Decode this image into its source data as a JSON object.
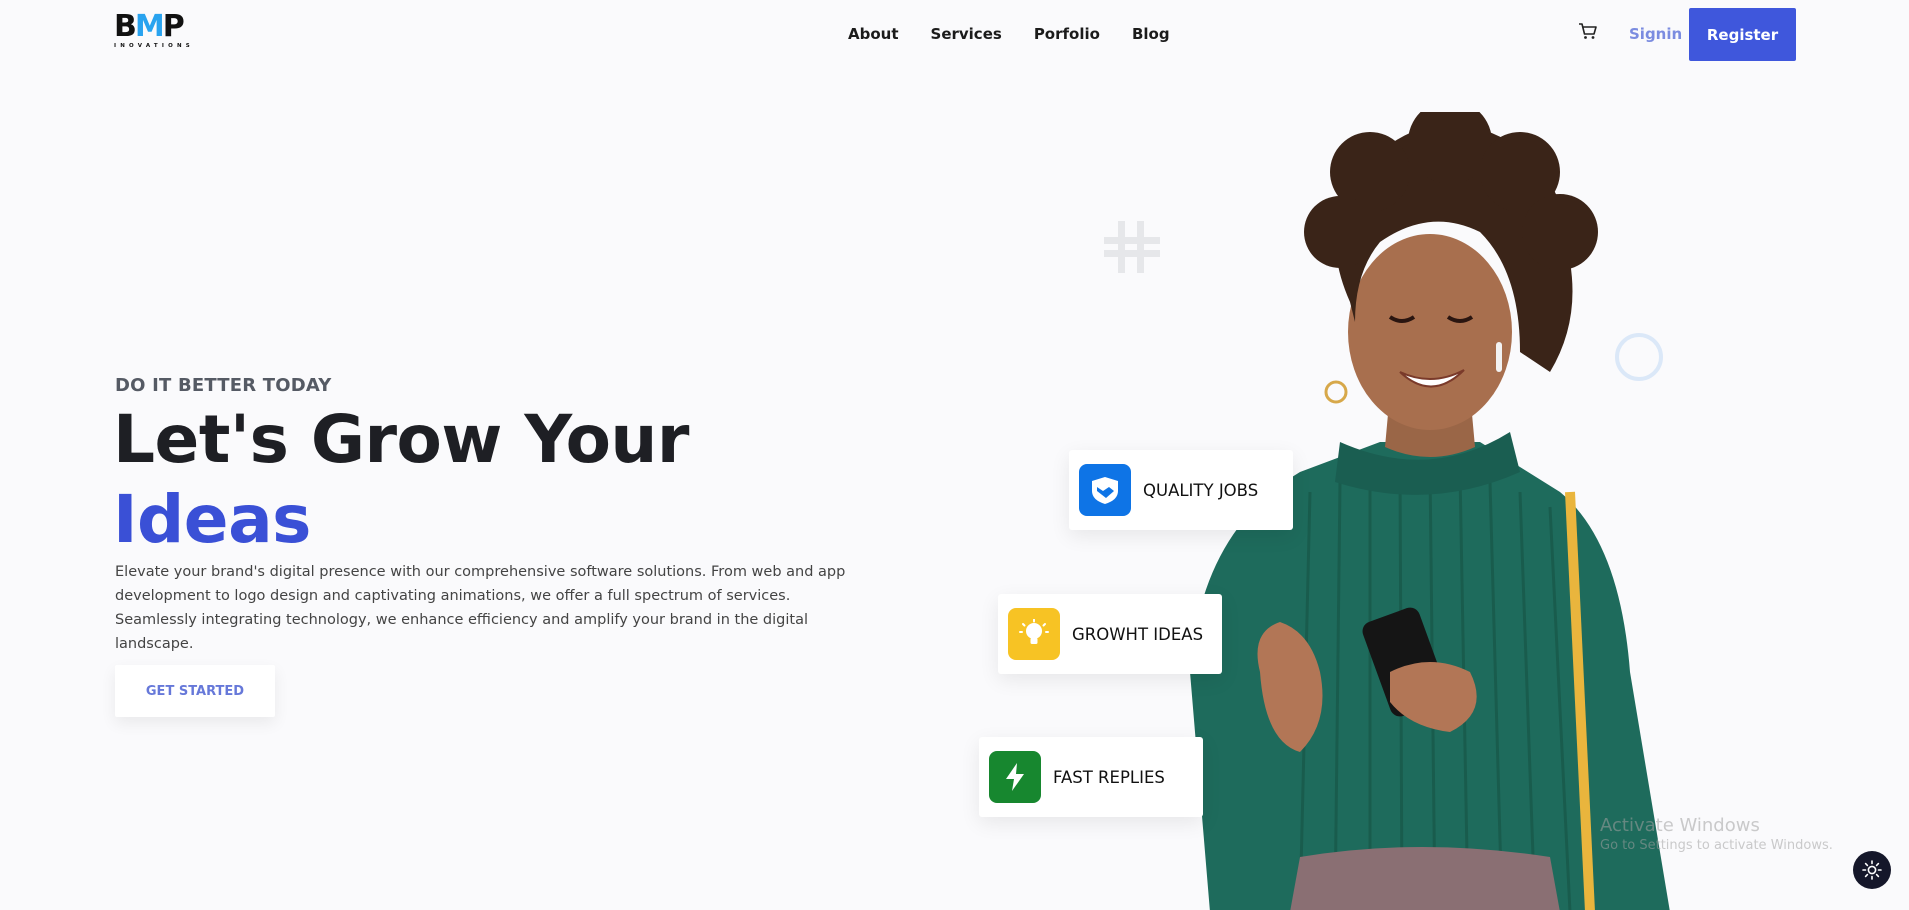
{
  "brand": {
    "logo_main": "BMP",
    "logo_sub": "INOVATIONS"
  },
  "nav": {
    "items": [
      "About",
      "Services",
      "Porfolio",
      "Blog"
    ],
    "cart_icon": "cart-icon",
    "signin": "Signin",
    "register": "Register"
  },
  "hero": {
    "eyebrow": "DO IT BETTER TODAY",
    "title_line1": "Let's Grow Your",
    "title_line2": "Ideas",
    "description": "Elevate your brand's digital presence with our comprehensive software solutions. From web and app development to logo design and captivating animations, we offer a full spectrum of services. Seamlessly integrating technology, we enhance efficiency and amplify your brand in the digital landscape.",
    "cta": "GET STARTED"
  },
  "features": [
    {
      "label": "QUALITY JOBS",
      "icon": "handshake-icon",
      "color": "#0e74e6"
    },
    {
      "label": "GROWHT IDEAS",
      "icon": "lightbulb-icon",
      "color": "#f7c324"
    },
    {
      "label": "FAST REPLIES",
      "icon": "lightning-icon",
      "color": "#17872f"
    }
  ],
  "watermark": {
    "line1": "Activate Windows",
    "line2": "Go to Settings to activate Windows."
  },
  "theme_toggle_icon": "sun-icon",
  "colors": {
    "accent": "#3f57dc",
    "accent_text": "#3a50d6",
    "link": "#7b8ce0",
    "background": "#fafafc"
  }
}
